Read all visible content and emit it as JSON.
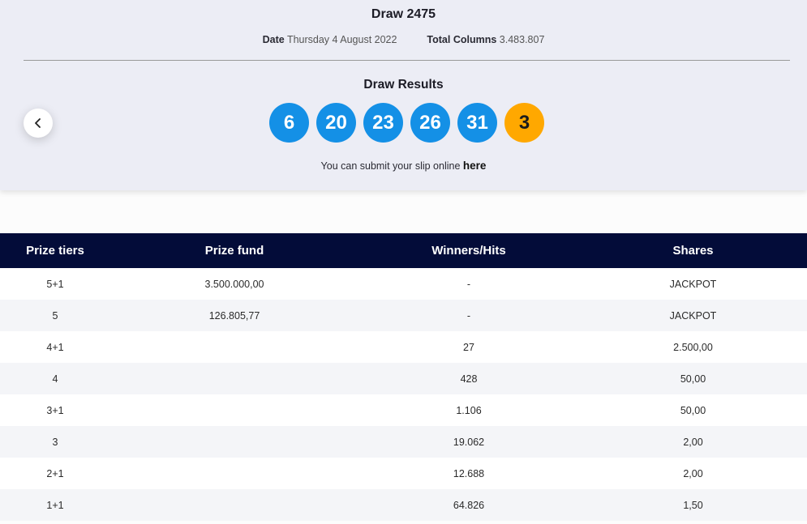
{
  "draw": {
    "title": "Draw 2475",
    "date_label": "Date",
    "date_value": "Thursday 4 August 2022",
    "columns_label": "Total Columns",
    "columns_value": "3.483.807"
  },
  "results": {
    "title": "Draw Results",
    "numbers": [
      "6",
      "20",
      "23",
      "26",
      "31"
    ],
    "bonus": "3",
    "submit_text": "You can submit your slip online",
    "submit_link": "here"
  },
  "nav": {
    "prev_icon": "chevron-left-icon"
  },
  "colors": {
    "ball_blue": "#1490e6",
    "ball_bonus": "#ffa800",
    "table_header": "#030c39"
  },
  "table": {
    "headers": [
      "Prize tiers",
      "Prize fund",
      "Winners/Hits",
      "Shares"
    ],
    "rows": [
      [
        "5+1",
        "3.500.000,00",
        "-",
        "JACKPOT"
      ],
      [
        "5",
        "126.805,77",
        "-",
        "JACKPOT"
      ],
      [
        "4+1",
        "",
        "27",
        "2.500,00"
      ],
      [
        "4",
        "",
        "428",
        "50,00"
      ],
      [
        "3+1",
        "",
        "1.106",
        "50,00"
      ],
      [
        "3",
        "",
        "19.062",
        "2,00"
      ],
      [
        "2+1",
        "",
        "12.688",
        "2,00"
      ],
      [
        "1+1",
        "",
        "64.826",
        "1,50"
      ]
    ]
  }
}
